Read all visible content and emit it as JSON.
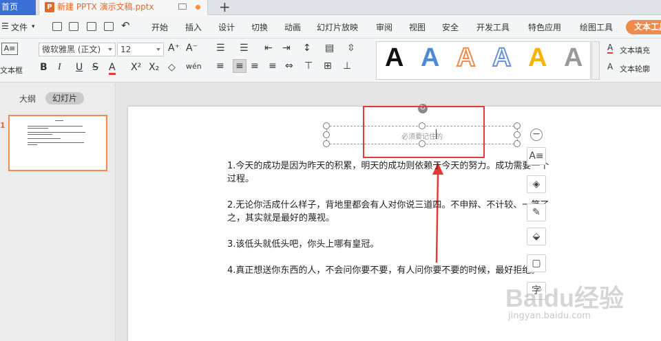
{
  "titlebar": {
    "home_tab": "首页",
    "doc_tab": "新建 PPTX 演示文稿.pptx",
    "doc_icon": "P",
    "new_tab": "+"
  },
  "menubar": {
    "file": "文件",
    "items": [
      "开始",
      "插入",
      "设计",
      "切换",
      "动画",
      "幻灯片放映",
      "审阅",
      "视图",
      "安全",
      "开发工具",
      "特色应用",
      "绘图工具"
    ],
    "active": "文本工具"
  },
  "ribbon": {
    "textbox_label": "文本框",
    "font_name": "微软雅黑 (正文)",
    "font_size": "12",
    "text_fill": "文本填充",
    "text_outline": "文本轮廓",
    "gallery_letter": "A",
    "colors": {
      "brand": "#f08a4b",
      "link": "#3b6fd6",
      "highlight": "#e53935"
    }
  },
  "leftpanel": {
    "outline_tab": "大纲",
    "slides_tab": "幻灯片",
    "slide_number": "1"
  },
  "slide": {
    "placeholder": "必须要记住的",
    "paragraphs": [
      "1.今天的成功是因为昨天的积累，明天的成功则依赖于今天的努力。成功需要一个过程。",
      "2.无论你活成什么样子，背地里都会有人对你说三道四。不申辩、不计较、一笑了之，其实就是最好的蔑视。",
      "3.该低头就低头吧，你头上哪有皇冠。",
      "4.真正想送你东西的人，不会问你要不要，有人问你要不要的时候，最好拒绝。"
    ]
  },
  "float_toolbar": {
    "collapse": "−",
    "char_btn": "字"
  },
  "watermark": {
    "main": "Baidu经验",
    "sub": "jingyan.baidu.com"
  }
}
